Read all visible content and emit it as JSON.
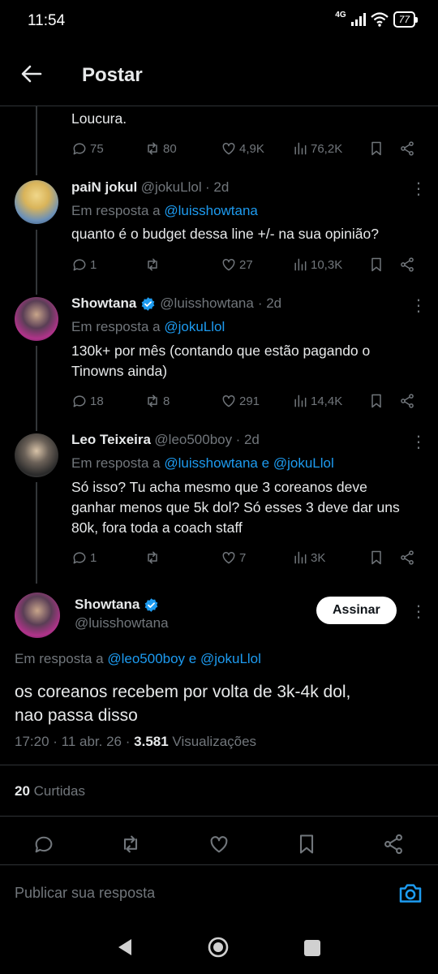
{
  "status": {
    "time": "11:54",
    "network": "4G",
    "battery": "77"
  },
  "header": {
    "title": "Postar"
  },
  "tweets": [
    {
      "text": "Loucura.",
      "replies": "75",
      "retweets": "80",
      "likes": "4,9K",
      "views": "76,2K"
    },
    {
      "name": "paiN jokul",
      "handle": "@jokuLlol",
      "time": "· 2d",
      "reply_prefix": "Em resposta a",
      "reply_to": "@luisshowtana",
      "text": "quanto é o budget dessa line +/- na sua opinião?",
      "replies": "1",
      "retweets": "",
      "likes": "27",
      "views": "10,3K"
    },
    {
      "name": "Showtana",
      "handle": "@luisshowtana",
      "time": "· 2d",
      "reply_prefix": "Em resposta a",
      "reply_to": "@jokuLlol",
      "text_line1": "130k+  por mês (contando que estão pagando o",
      "text_line2": "Tinowns ainda)",
      "replies": "18",
      "retweets": "8",
      "likes": "291",
      "views": "14,4K"
    },
    {
      "name": "Leo Teixeira",
      "handle": "@leo500boy",
      "time": "· 2d",
      "reply_prefix": "Em resposta a",
      "reply_to_1": "@luisshowtana",
      "reply_and": "e",
      "reply_to_2": "@jokuLlol",
      "text_line1": "Só isso? Tu acha mesmo que 3 coreanos deve",
      "text_line2": "ganhar menos que 5k dol? Só esses 3 deve dar uns",
      "text_line3": "80k, fora toda a coach staff",
      "replies": "1",
      "retweets": "",
      "likes": "7",
      "views": "3K"
    }
  ],
  "main": {
    "name": "Showtana",
    "handle": "@luisshowtana",
    "follow_label": "Assinar",
    "reply_prefix": "Em resposta a",
    "reply_to_1": "@leo500boy",
    "reply_and": "e",
    "reply_to_2": "@jokuLlol",
    "text_line1": "os coreanos recebem por volta de 3k-4k dol,",
    "text_line2": "nao passa disso",
    "timestamp": "17:20 · 11 abr. 26 ·",
    "views_count": "3.581",
    "views_label": "Visualizações",
    "likes_count": "20",
    "likes_label": "Curtidas"
  },
  "reply_bar": {
    "placeholder": "Publicar sua resposta"
  },
  "colors": {
    "accent": "#1d9bf0",
    "background": "#000000",
    "text": "#e7e9ea",
    "muted": "#71767b"
  }
}
